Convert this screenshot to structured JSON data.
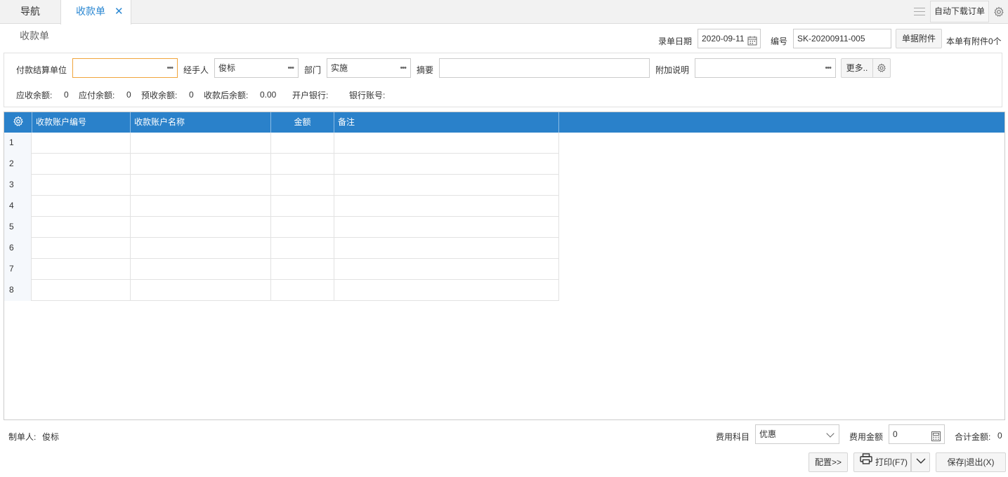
{
  "tabs": {
    "nav": "导航",
    "active": "收款单",
    "close": "✕"
  },
  "toolbar": {
    "auto_download": "自动下载订单"
  },
  "page_title": "收款单",
  "header": {
    "date_label": "录单日期",
    "date_value": "2020-09-11",
    "number_label": "编号",
    "number_value": "SK-20200911-005",
    "attach_button": "单据附件",
    "attach_info": "本单有附件0个"
  },
  "form": {
    "payer_label": "付款结算单位",
    "payer_value": "",
    "handler_label": "经手人",
    "handler_value": "俊标",
    "dept_label": "部门",
    "dept_value": "实施",
    "summary_label": "摘要",
    "summary_value": "",
    "note_label": "附加说明",
    "note_value": "",
    "more_button": "更多..",
    "dots": "•••"
  },
  "balances": {
    "receivable_label": "应收余额:",
    "receivable_value": "0",
    "payable_label": "应付余额:",
    "payable_value": "0",
    "prepaid_label": "预收余额:",
    "prepaid_value": "0",
    "after_label": "收款后余额:",
    "after_value": "0.00",
    "bank_label": "开户银行:",
    "account_label": "银行账号:"
  },
  "grid": {
    "columns": [
      "收款账户编号",
      "收款账户名称",
      "金额",
      "备注"
    ],
    "rows": [
      "1",
      "2",
      "3",
      "4",
      "5",
      "6",
      "7",
      "8"
    ]
  },
  "footer": {
    "maker_label": "制单人:",
    "maker_value": "俊标",
    "fee_subject_label": "费用科目",
    "fee_subject_value": "优惠",
    "fee_amount_label": "费用金额",
    "fee_amount_value": "0",
    "total_label": "合计金额:",
    "total_value": "0",
    "config_button": "配置>>",
    "print_button": "打印(F7)",
    "save_exit_button": "保存|退出(X)"
  },
  "colors": {
    "accent": "#2a81ca",
    "tab_active": "#2a87d2",
    "focus_border": "#f0a53c"
  }
}
